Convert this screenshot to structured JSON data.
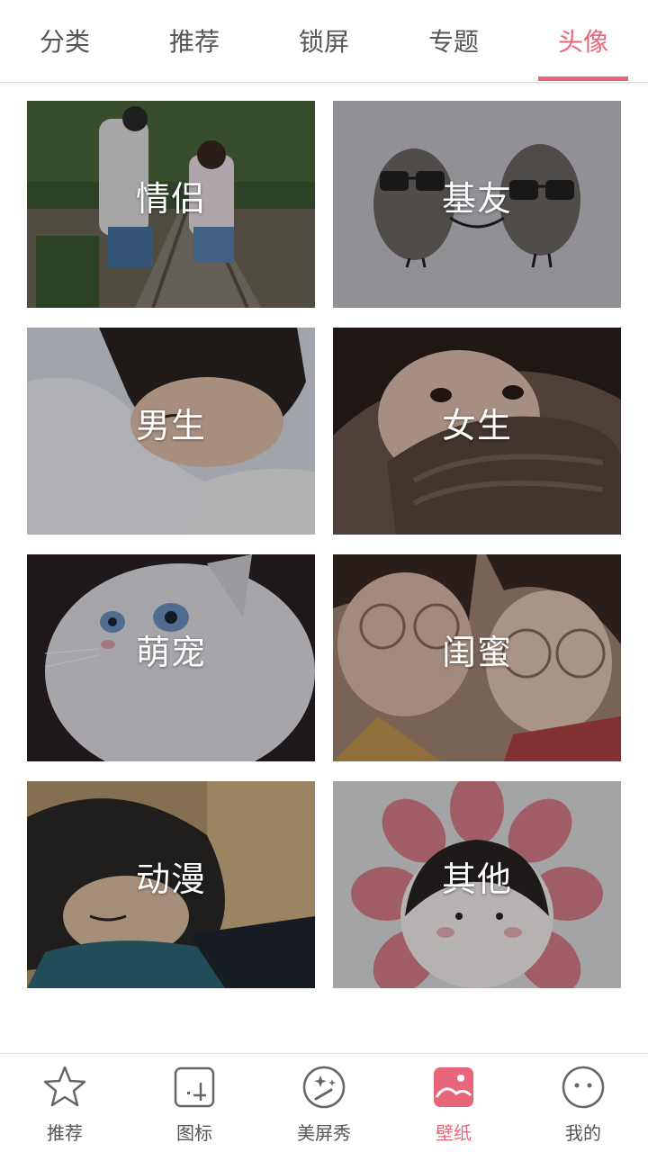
{
  "top_tabs": [
    {
      "label": "分类",
      "active": false
    },
    {
      "label": "推荐",
      "active": false
    },
    {
      "label": "锁屏",
      "active": false
    },
    {
      "label": "专题",
      "active": false
    },
    {
      "label": "头像",
      "active": true
    }
  ],
  "categories": [
    {
      "label": "情侣",
      "image": "couple-walking-on-railway"
    },
    {
      "label": "基友",
      "image": "two-stones-with-sunglasses"
    },
    {
      "label": "男生",
      "image": "boy-sleeping-on-pillow"
    },
    {
      "label": "女生",
      "image": "girl-with-knit-scarf"
    },
    {
      "label": "萌宠",
      "image": "white-kitten-blue-eyes"
    },
    {
      "label": "闺蜜",
      "image": "two-girls-with-glasses"
    },
    {
      "label": "动漫",
      "image": "anime-boy-with-scarf"
    },
    {
      "label": "其他",
      "image": "cartoon-girl-in-flower"
    }
  ],
  "bottom_nav": [
    {
      "label": "推荐",
      "icon": "star-icon",
      "active": false
    },
    {
      "label": "图标",
      "icon": "app-icon",
      "active": false
    },
    {
      "label": "美屏秀",
      "icon": "magic-wand-icon",
      "active": false
    },
    {
      "label": "壁纸",
      "icon": "wallpaper-icon",
      "active": true
    },
    {
      "label": "我的",
      "icon": "face-icon",
      "active": false
    }
  ],
  "colors": {
    "accent": "#e8667a",
    "tab_text": "#555555",
    "nav_icon": "#666666"
  }
}
